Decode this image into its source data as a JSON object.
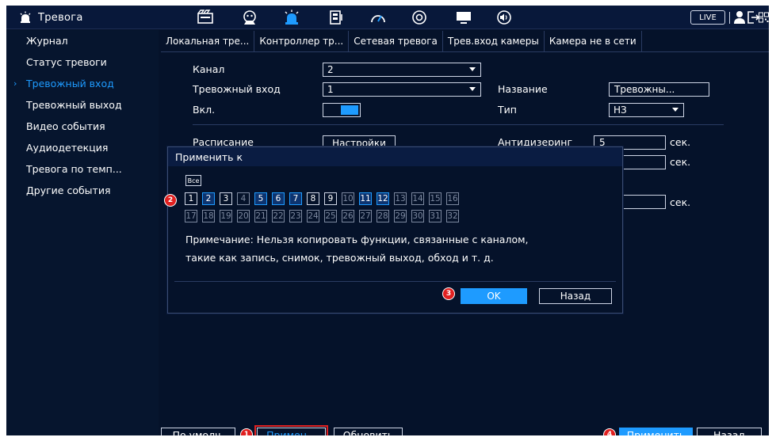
{
  "header": {
    "title": "Тревога",
    "live_label": "LIVE",
    "icons": [
      "alarm-icon",
      "record-icon",
      "face-icon",
      "alarm-active-icon",
      "storage-icon",
      "speed-icon",
      "camera-icon",
      "display-icon",
      "audio-icon",
      "user-icon",
      "logout-icon",
      "qr-icon"
    ]
  },
  "sidebar": {
    "items": [
      {
        "label": "Журнал"
      },
      {
        "label": "Статус тревоги"
      },
      {
        "label": "Тревожный вход"
      },
      {
        "label": "Тревожный выход"
      },
      {
        "label": "Видео события"
      },
      {
        "label": "Аудиодетекция"
      },
      {
        "label": "Тревога по темп..."
      },
      {
        "label": "Другие события"
      }
    ]
  },
  "tabs": [
    {
      "label": "Локальная тре..."
    },
    {
      "label": "Контроллер тр..."
    },
    {
      "label": "Сетевая тревога"
    },
    {
      "label": "Трев.вход камеры"
    },
    {
      "label": "Камера не в сети"
    }
  ],
  "form": {
    "channel_label": "Канал",
    "channel_value": "2",
    "alarm_input_label": "Тревожный вход",
    "alarm_input_value": "1",
    "name_label": "Название",
    "name_value": "Тревожны...",
    "enable_label": "Вкл.",
    "type_label": "Тип",
    "type_value": "НЗ",
    "schedule_label": "Расписание",
    "schedule_button": "Настройки",
    "antidither_label": "Антидизеринг",
    "antidither_value": "5",
    "seconds_unit": "сек."
  },
  "modal": {
    "title": "Применить к",
    "all_label": "Все",
    "channels": [
      "1",
      "2",
      "3",
      "4",
      "5",
      "6",
      "7",
      "8",
      "9",
      "10",
      "11",
      "12",
      "13",
      "14",
      "15",
      "16",
      "17",
      "18",
      "19",
      "20",
      "21",
      "22",
      "23",
      "24",
      "25",
      "26",
      "27",
      "28",
      "29",
      "30",
      "31",
      "32"
    ],
    "note_line1": "Примечание: Нельзя копировать функции, связанные с каналом,",
    "note_line2": "такие как запись, снимок, тревожный выход, обход и т. д.",
    "ok_label": "OK",
    "back_label": "Назад"
  },
  "bottom": {
    "default_label": "По умолч.",
    "apply_short_label": "Примен...",
    "refresh_label": "Обновить",
    "apply_label": "Применить",
    "back_label": "Назад"
  },
  "badges": [
    "1",
    "2",
    "3",
    "4"
  ],
  "colors": {
    "accent": "#1e9bff",
    "background": "#05122a",
    "marker": "#e02020"
  }
}
